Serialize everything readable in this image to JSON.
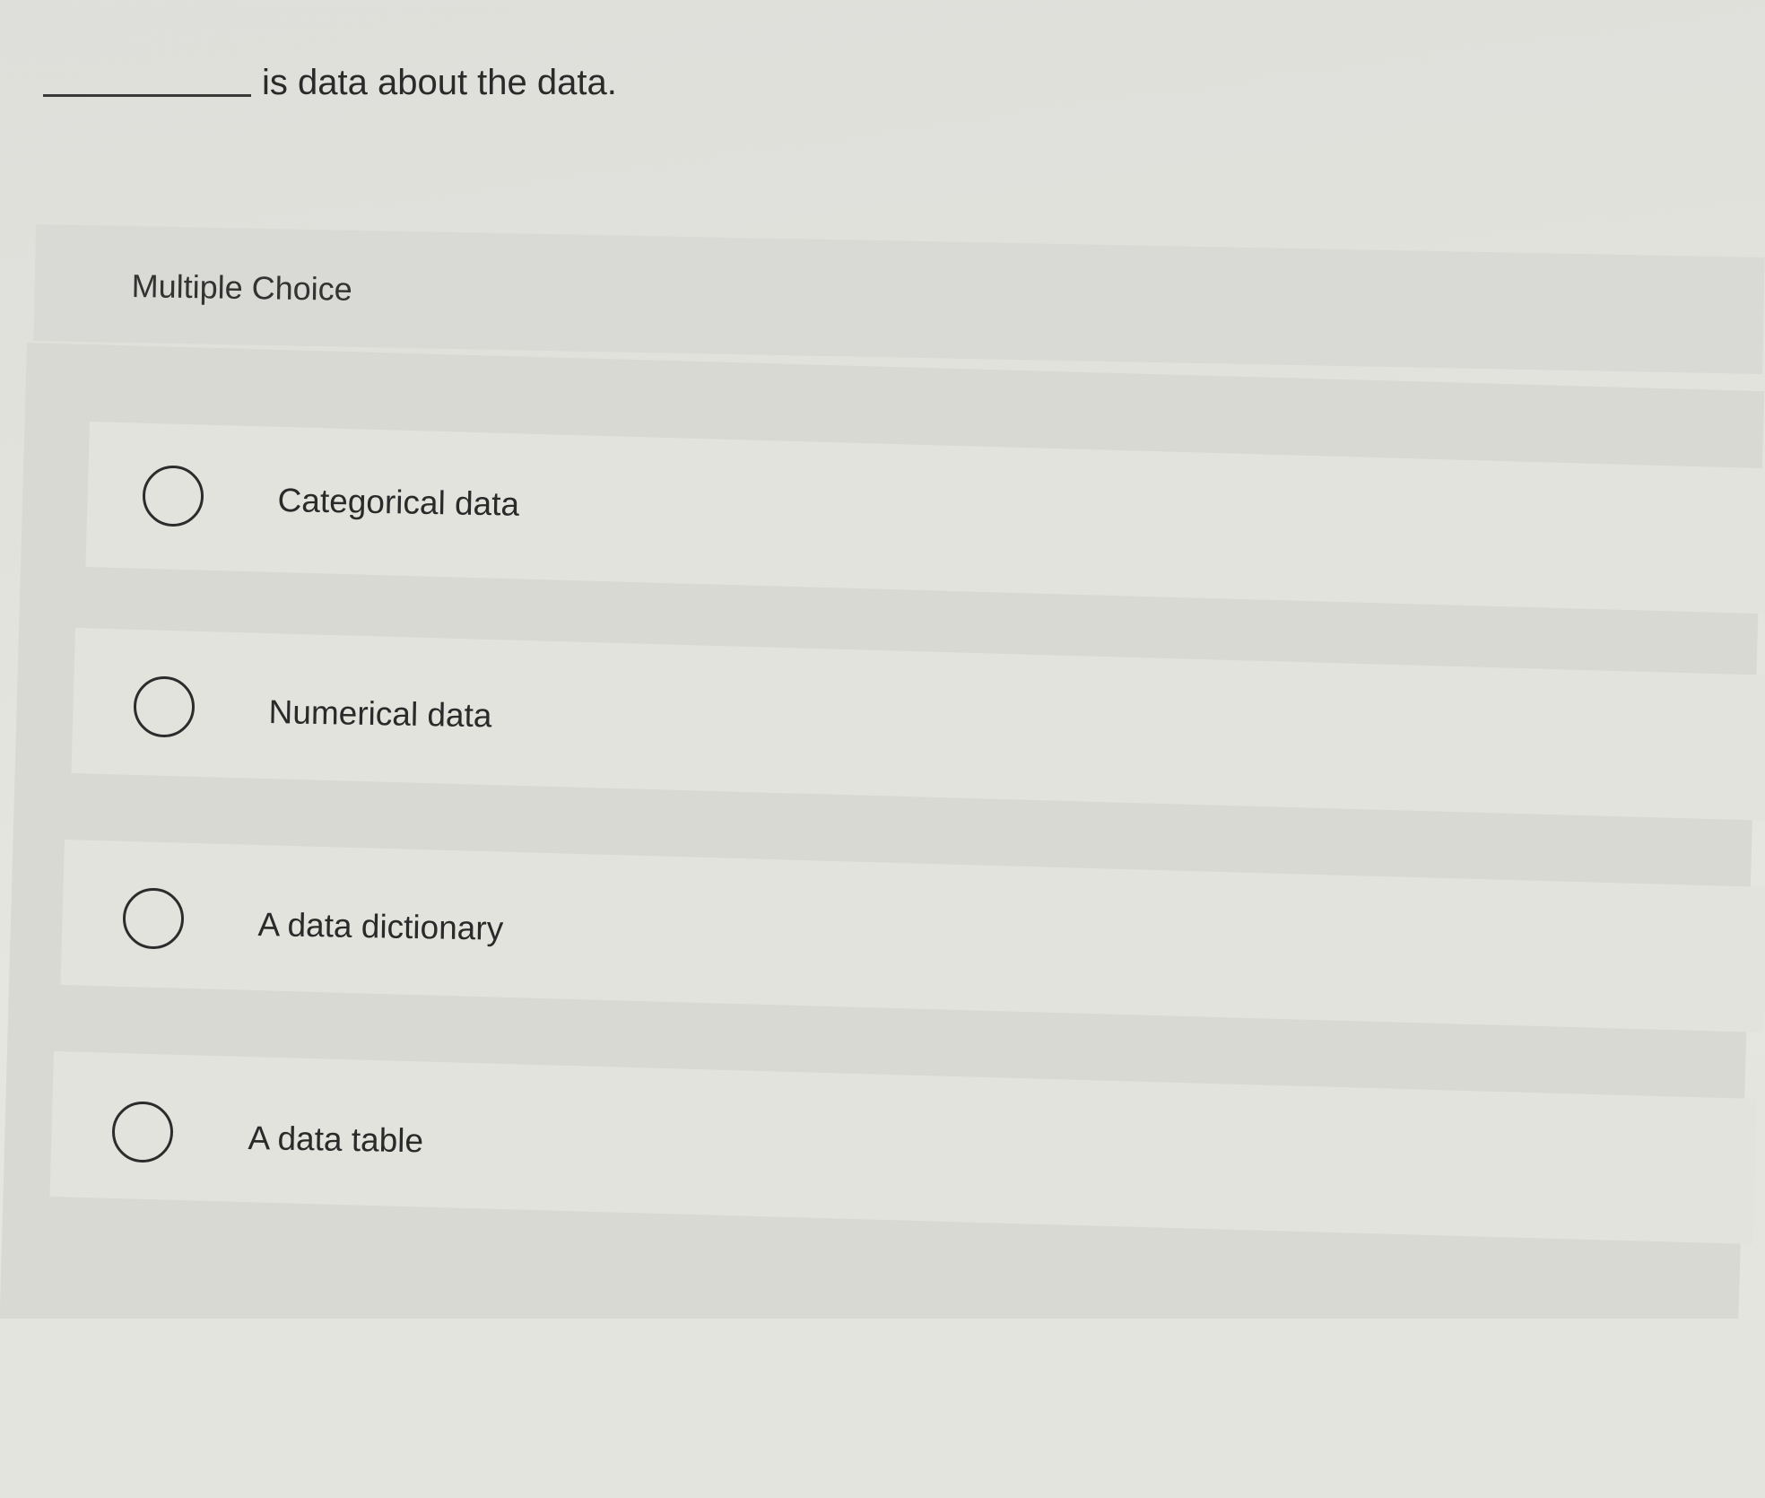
{
  "question": {
    "text": "is data about the data."
  },
  "section": {
    "label": "Multiple Choice"
  },
  "options": [
    {
      "label": "Categorical data",
      "selected": false
    },
    {
      "label": "Numerical data",
      "selected": false
    },
    {
      "label": "A data dictionary",
      "selected": false
    },
    {
      "label": "A data table",
      "selected": false
    }
  ]
}
